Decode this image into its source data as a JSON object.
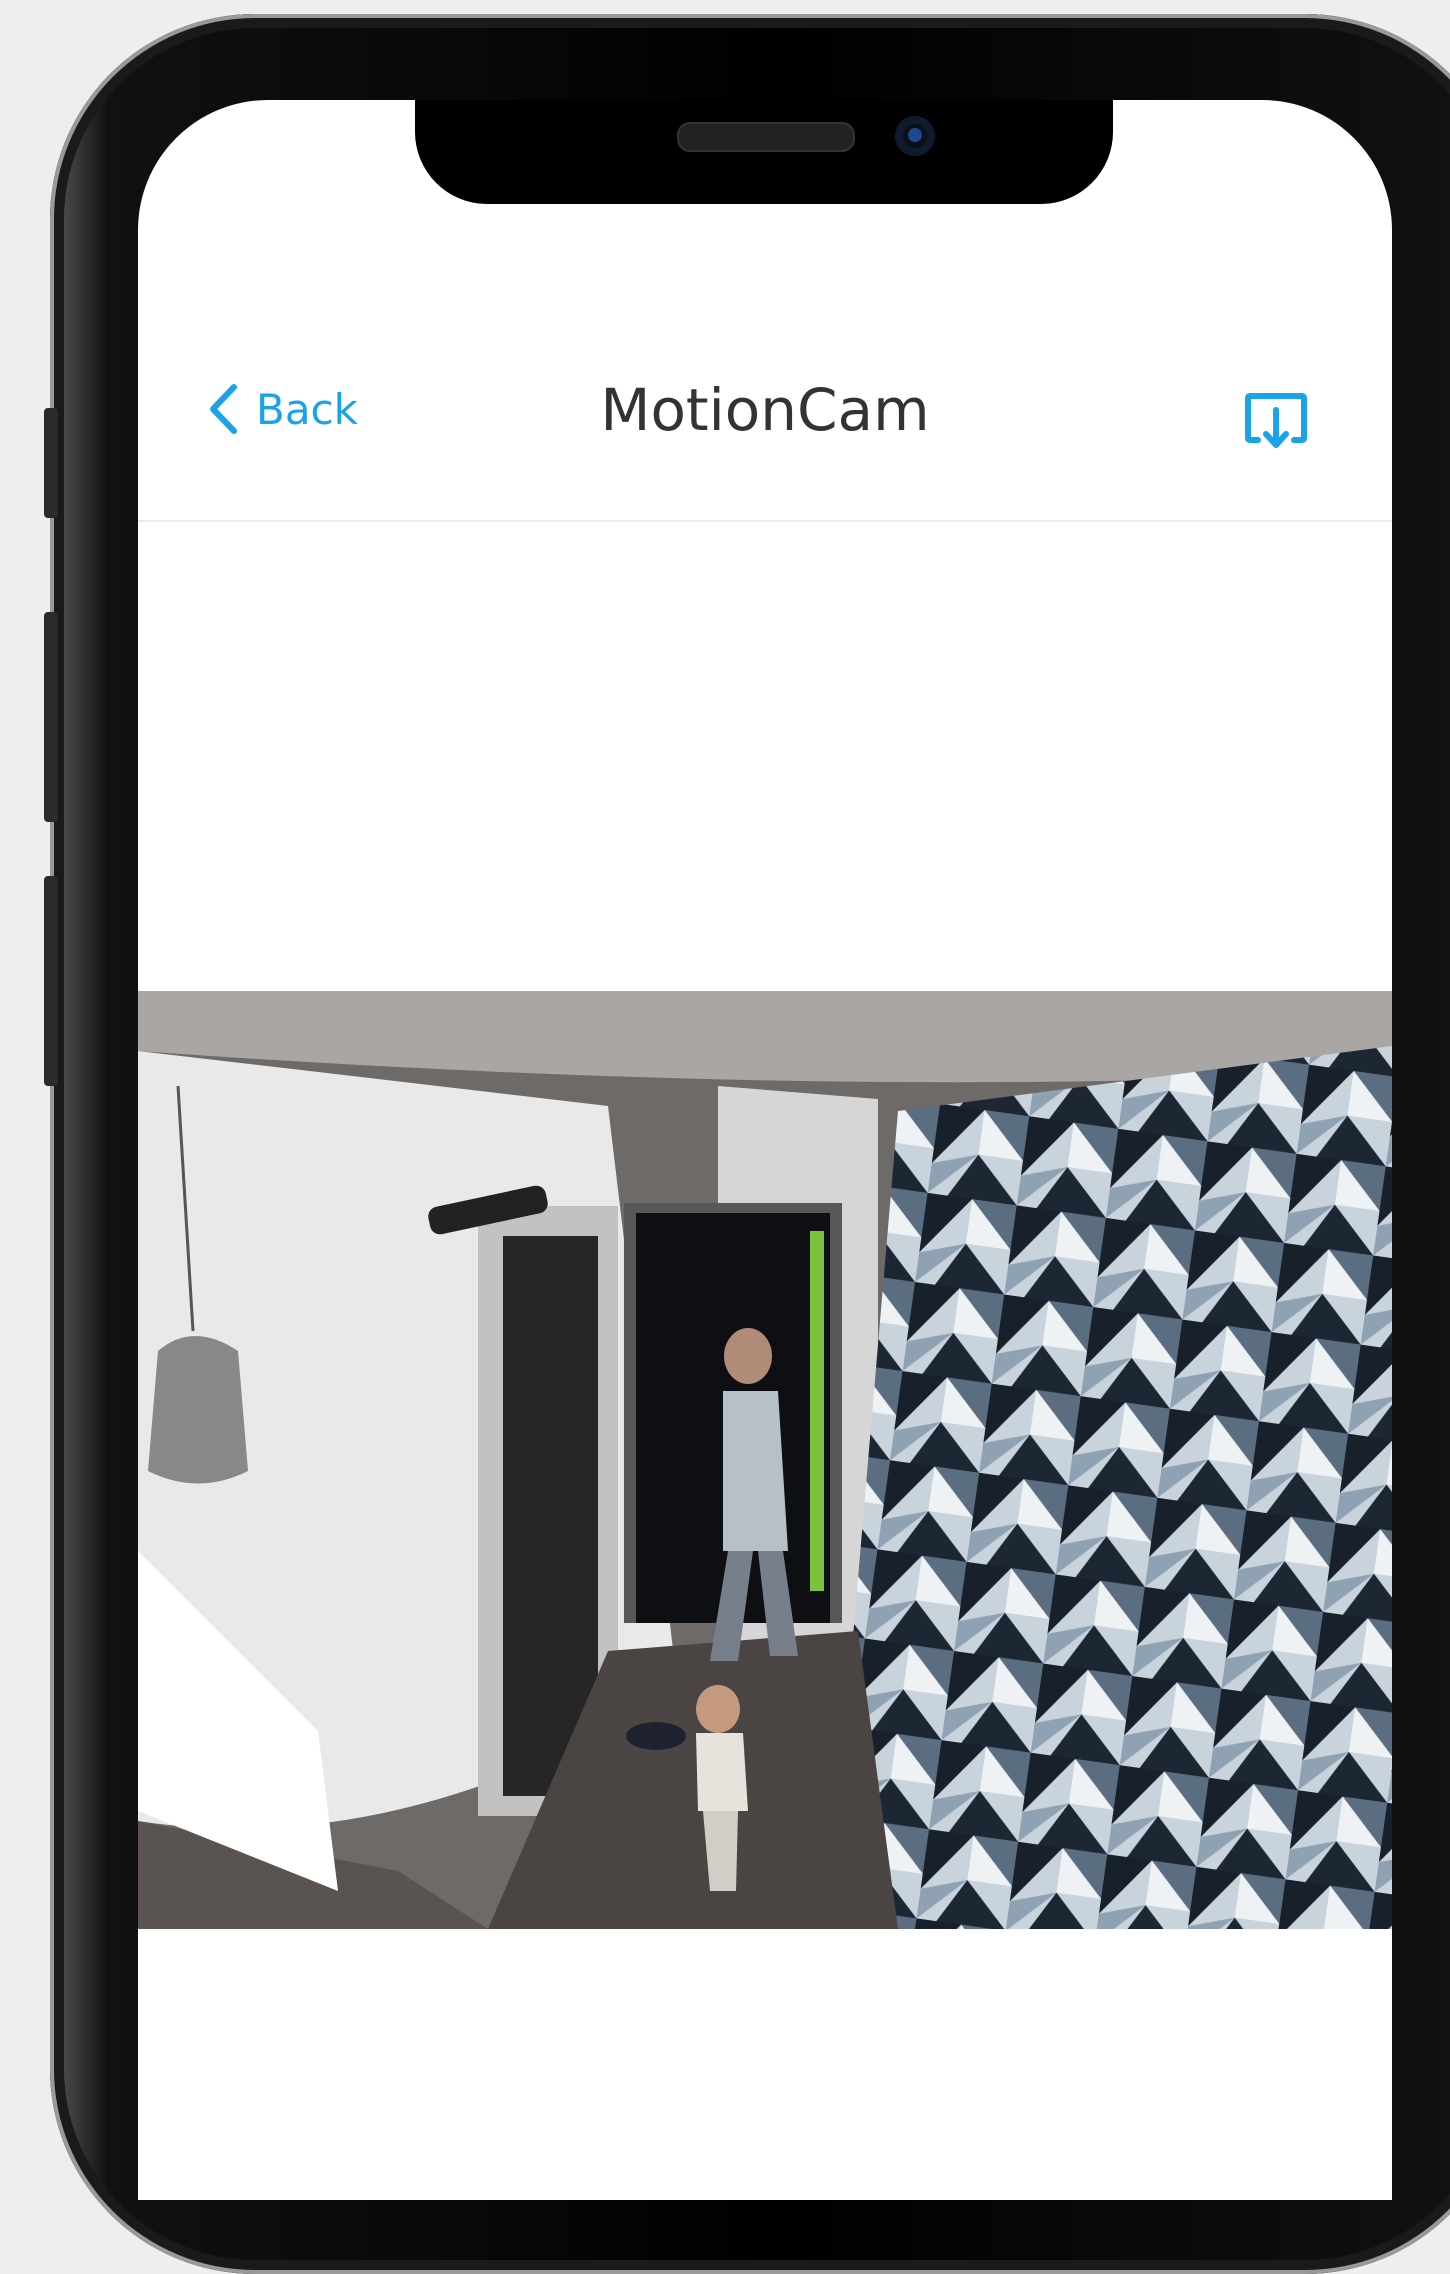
{
  "nav": {
    "back_label": "Back",
    "title": "MotionCam"
  },
  "icons": {
    "back": "chevron-left-icon",
    "download": "download-icon"
  },
  "colors": {
    "accent": "#1aa3e8",
    "title_text": "#333333",
    "screen_background": "#ffffff"
  }
}
